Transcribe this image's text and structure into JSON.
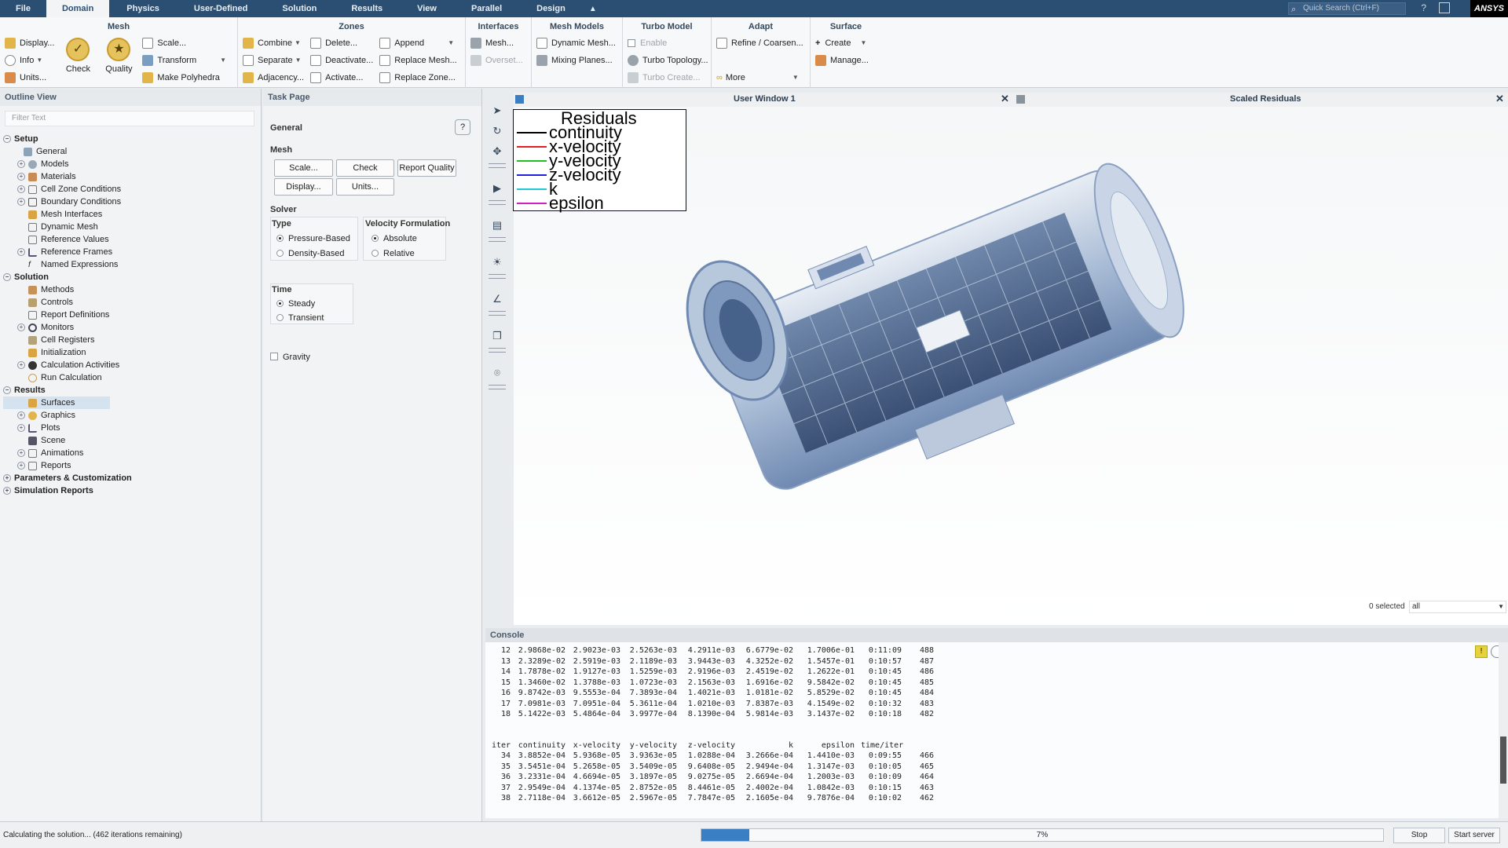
{
  "menubar": {
    "tabs": [
      "File",
      "Domain",
      "Physics",
      "User-Defined",
      "Solution",
      "Results",
      "View",
      "Parallel",
      "Design"
    ],
    "quick_search_placeholder": "Quick Search (Ctrl+F)",
    "logo": "ANSYS"
  },
  "ribbon": {
    "mesh": {
      "title": "Mesh",
      "display": "Display...",
      "info": "Info",
      "units": "Units...",
      "check": "Check",
      "quality": "Quality",
      "scale": "Scale...",
      "transform": "Transform",
      "make_polyhedra": "Make Polyhedra"
    },
    "zones": {
      "title": "Zones",
      "combine": "Combine",
      "separate": "Separate",
      "adjacency": "Adjacency...",
      "delete": "Delete...",
      "deactivate": "Deactivate...",
      "activate": "Activate...",
      "append": "Append",
      "replace_mesh": "Replace Mesh...",
      "replace_zone": "Replace Zone..."
    },
    "interfaces": {
      "title": "Interfaces",
      "mesh": "Mesh...",
      "overset": "Overset..."
    },
    "mesh_models": {
      "title": "Mesh Models",
      "dynamic_mesh": "Dynamic Mesh...",
      "mixing_planes": "Mixing Planes..."
    },
    "turbo_model": {
      "title": "Turbo Model",
      "enable": "Enable",
      "turbo_topology": "Turbo Topology...",
      "turbo_create": "Turbo Create..."
    },
    "adapt": {
      "title": "Adapt",
      "refine": "Refine / Coarsen...",
      "more": "More"
    },
    "surface": {
      "title": "Surface",
      "create": "Create",
      "manage": "Manage..."
    }
  },
  "outline": {
    "title": "Outline View",
    "filter_placeholder": "Filter Text",
    "setup": {
      "label": "Setup",
      "items": [
        "General",
        "Models",
        "Materials",
        "Cell Zone Conditions",
        "Boundary Conditions",
        "Mesh Interfaces",
        "Dynamic Mesh",
        "Reference Values",
        "Reference Frames",
        "Named Expressions"
      ]
    },
    "solution": {
      "label": "Solution",
      "items": [
        "Methods",
        "Controls",
        "Report Definitions",
        "Monitors",
        "Cell Registers",
        "Initialization",
        "Calculation Activities",
        "Run Calculation"
      ]
    },
    "results": {
      "label": "Results",
      "items": [
        "Surfaces",
        "Graphics",
        "Plots",
        "Scene",
        "Animations",
        "Reports"
      ]
    },
    "parameters": "Parameters & Customization",
    "sim_reports": "Simulation Reports"
  },
  "taskpage": {
    "title": "Task Page",
    "heading": "General",
    "mesh_label": "Mesh",
    "btn_scale": "Scale...",
    "btn_check": "Check",
    "btn_report_quality": "Report Quality",
    "btn_display": "Display...",
    "btn_units": "Units...",
    "solver_label": "Solver",
    "type_label": "Type",
    "pressure_based": "Pressure-Based",
    "density_based": "Density-Based",
    "velocity_label": "Velocity Formulation",
    "absolute": "Absolute",
    "relative": "Relative",
    "time_label": "Time",
    "steady": "Steady",
    "transient": "Transient",
    "gravity": "Gravity"
  },
  "graphics": {
    "window1_title": "User Window 1",
    "window2_title": "Scaled Residuals",
    "legend": {
      "title": "Residuals",
      "entries": [
        {
          "label": "continuity",
          "color": "#000000"
        },
        {
          "label": "x-velocity",
          "color": "#e02020"
        },
        {
          "label": "y-velocity",
          "color": "#20c020"
        },
        {
          "label": "z-velocity",
          "color": "#2020e0"
        },
        {
          "label": "k",
          "color": "#20c8d8"
        },
        {
          "label": "epsilon",
          "color": "#d020c0"
        }
      ]
    },
    "selected": "0 selected",
    "selected_filter": "all"
  },
  "console": {
    "title": "Console",
    "rows_a": [
      [
        "12",
        "2.9868e-02",
        "2.9023e-03",
        "2.5263e-03",
        "4.2911e-03",
        "6.6779e-02",
        "1.7006e-01",
        "0:11:09",
        "488"
      ],
      [
        "13",
        "2.3289e-02",
        "2.5919e-03",
        "2.1189e-03",
        "3.9443e-03",
        "4.3252e-02",
        "1.5457e-01",
        "0:10:57",
        "487"
      ],
      [
        "14",
        "1.7878e-02",
        "1.9127e-03",
        "1.5259e-03",
        "2.9196e-03",
        "2.4519e-02",
        "1.2622e-01",
        "0:10:45",
        "486"
      ],
      [
        "15",
        "1.3460e-02",
        "1.3788e-03",
        "1.0723e-03",
        "2.1563e-03",
        "1.6916e-02",
        "9.5842e-02",
        "0:10:45",
        "485"
      ],
      [
        "16",
        "9.8742e-03",
        "9.5553e-04",
        "7.3893e-04",
        "1.4021e-03",
        "1.0181e-02",
        "5.8529e-02",
        "0:10:45",
        "484"
      ],
      [
        "17",
        "7.0981e-03",
        "7.0951e-04",
        "5.3611e-04",
        "1.0210e-03",
        "7.8387e-03",
        "4.1549e-02",
        "0:10:32",
        "483"
      ],
      [
        "18",
        "5.1422e-03",
        "5.4864e-04",
        "3.9977e-04",
        "8.1390e-04",
        "5.9814e-03",
        "3.1437e-02",
        "0:10:18",
        "482"
      ]
    ],
    "header": [
      "iter",
      "continuity",
      "x-velocity",
      "y-velocity",
      "z-velocity",
      "k",
      "epsilon",
      "time/iter"
    ],
    "rows_b": [
      [
        "34",
        "3.8852e-04",
        "5.9368e-05",
        "3.9363e-05",
        "1.0288e-04",
        "3.2666e-04",
        "1.4410e-03",
        "0:09:55",
        "466"
      ],
      [
        "35",
        "3.5451e-04",
        "5.2658e-05",
        "3.5409e-05",
        "9.6408e-05",
        "2.9494e-04",
        "1.3147e-03",
        "0:10:05",
        "465"
      ],
      [
        "36",
        "3.2331e-04",
        "4.6694e-05",
        "3.1897e-05",
        "9.0275e-05",
        "2.6694e-04",
        "1.2003e-03",
        "0:10:09",
        "464"
      ],
      [
        "37",
        "2.9549e-04",
        "4.1374e-05",
        "2.8752e-05",
        "8.4461e-05",
        "2.4002e-04",
        "1.0842e-03",
        "0:10:15",
        "463"
      ],
      [
        "38",
        "2.7118e-04",
        "3.6612e-05",
        "2.5967e-05",
        "7.7847e-05",
        "2.1605e-04",
        "9.7876e-04",
        "0:10:02",
        "462"
      ]
    ]
  },
  "status": {
    "message": "Calculating the solution... (462 iterations remaining)",
    "progress_percent": 7,
    "progress_text": "7%",
    "stop": "Stop",
    "start_server": "Start server"
  }
}
